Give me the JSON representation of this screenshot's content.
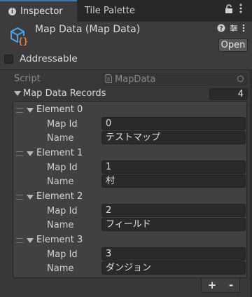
{
  "tabs": [
    {
      "label": "Inspector",
      "icon": "info-icon",
      "active": true
    },
    {
      "label": "Tile Palette",
      "active": false
    }
  ],
  "header": {
    "title": "Map Data (Map Data)",
    "open_label": "Open"
  },
  "addressable": {
    "label": "Addressable",
    "checked": false
  },
  "script": {
    "label": "Script",
    "value": "MapData"
  },
  "list": {
    "title": "Map Data Records",
    "count": "4",
    "elements": [
      {
        "label": "Element 0",
        "fields": [
          {
            "label": "Map Id",
            "value": "0"
          },
          {
            "label": "Name",
            "value": "テストマップ"
          }
        ]
      },
      {
        "label": "Element 1",
        "fields": [
          {
            "label": "Map Id",
            "value": "1"
          },
          {
            "label": "Name",
            "value": "村"
          }
        ]
      },
      {
        "label": "Element 2",
        "fields": [
          {
            "label": "Map Id",
            "value": "2"
          },
          {
            "label": "Name",
            "value": "フィールド"
          }
        ]
      },
      {
        "label": "Element 3",
        "fields": [
          {
            "label": "Map Id",
            "value": "3"
          },
          {
            "label": "Name",
            "value": "ダンジョン"
          }
        ]
      }
    ],
    "add_label": "+",
    "remove_label": "-"
  },
  "colors": {
    "accent": "#3a79bb",
    "asset_icon": "#4ea3e6",
    "brace": "#e8843a"
  }
}
